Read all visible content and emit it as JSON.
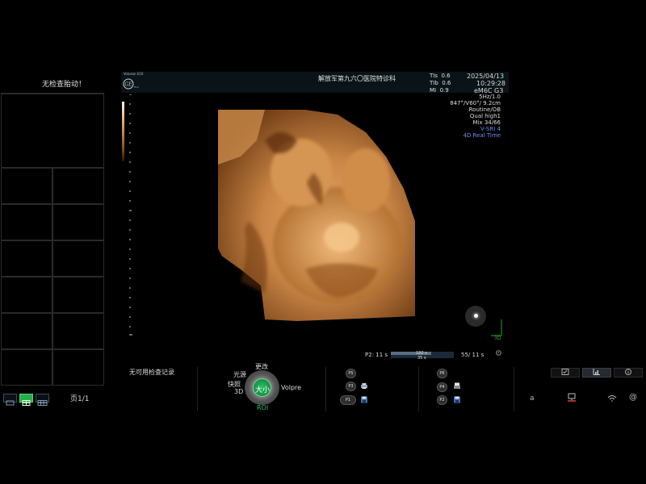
{
  "status_message": "无检查胎动！",
  "header": {
    "logo_text": "Voluson E10",
    "hospital": "解放军第九六〇医院特诊科",
    "indices": [
      {
        "label": "TIs",
        "value": "0.6"
      },
      {
        "label": "TIb",
        "value": "0.6"
      },
      {
        "label": "MI",
        "value": "0.9"
      }
    ],
    "date": "2025/04/13",
    "time": "10:29:28",
    "probe": "eM6C G3"
  },
  "params": [
    {
      "text": "5Hz/1.0",
      "color": "white"
    },
    {
      "text": "847°/V60°/ 9.2cm",
      "color": "white"
    },
    {
      "text": "Routine/OB",
      "color": "white"
    },
    {
      "text": "Qual high1",
      "color": "white"
    },
    {
      "text": "Mix 34/66",
      "color": "white"
    },
    {
      "text": "V-SRI 4",
      "color": "blue"
    },
    {
      "text": "4D Real Time",
      "color": "blue"
    }
  ],
  "orientation": {
    "axis_label": "3D"
  },
  "cine": {
    "left_label": "P2: 11 s",
    "bar_text1": "180 s",
    "bar_text2": "35 s",
    "right_label": "55/ 11 s"
  },
  "bottom": {
    "no_records": "无可用检查记录",
    "page": "页1/1",
    "knob": {
      "center": "大小",
      "top": "更改",
      "upper_left": "光源",
      "left": "快照",
      "lower_left": "3D",
      "right": "Volpre",
      "bottom": "ROI"
    },
    "presets_left": [
      "P5",
      "P3",
      "P1"
    ],
    "presets_right": [
      "P6",
      "P4",
      "P2"
    ]
  },
  "system_icons": {
    "letter": "a",
    "at": "@"
  },
  "colors": {
    "accent_green": "#2ec06a",
    "param_blue": "#6a8ff0",
    "header_bg": "#0a1418"
  }
}
